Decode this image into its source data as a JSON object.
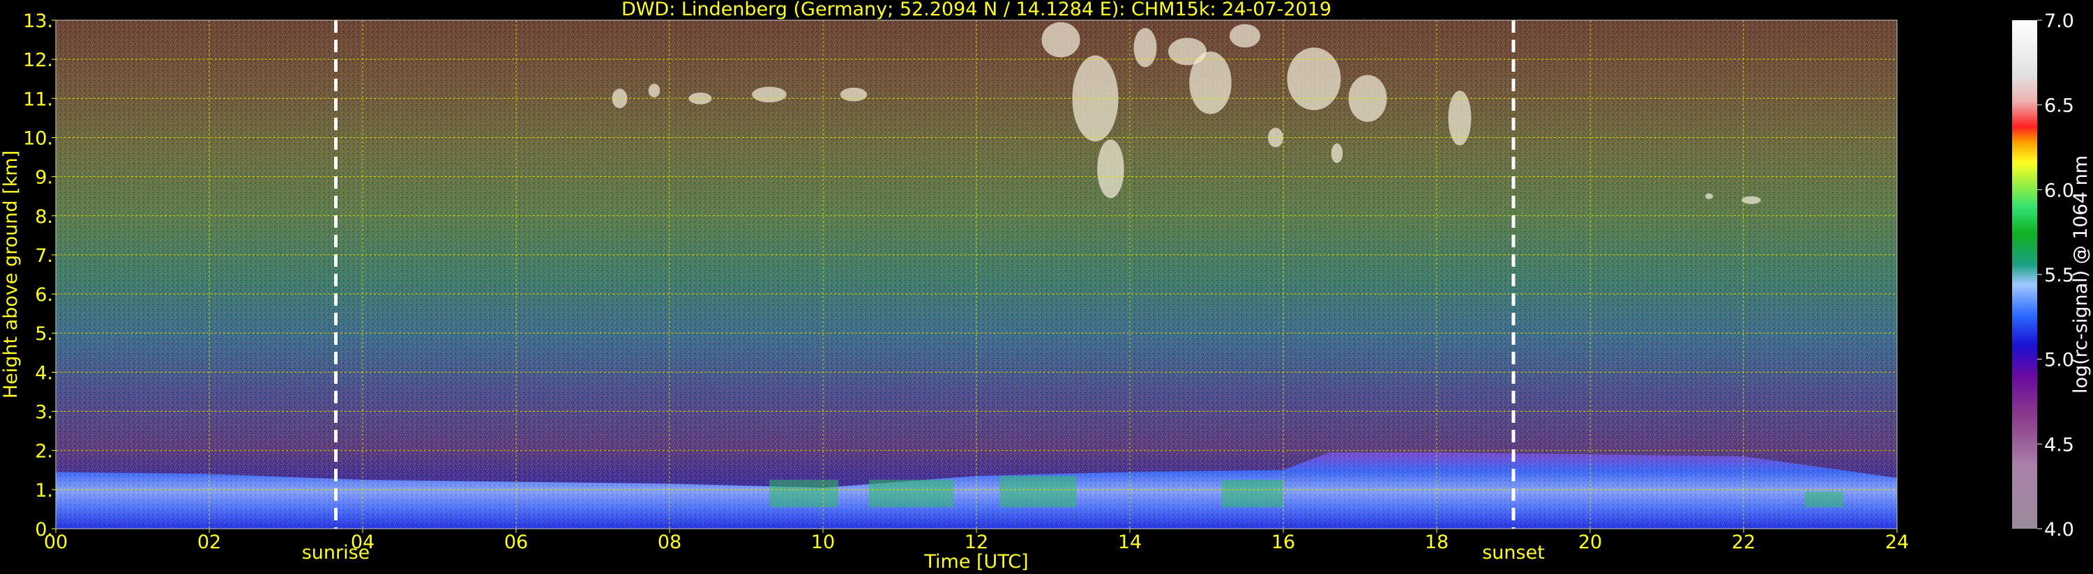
{
  "chart_data": {
    "type": "heatmap",
    "title": "DWD: Lindenberg (Germany; 52.2094 N / 14.1284 E):    CHM15k: 24-07-2019",
    "xlabel": "Time [UTC]",
    "ylabel": "Height above ground [km]",
    "colorbar_label": "log(rc-signal) @ 1064 nm",
    "xlim": [
      0,
      24
    ],
    "ylim": [
      0,
      13
    ],
    "x_ticks": [
      "00",
      "02",
      "04",
      "06",
      "08",
      "10",
      "12",
      "14",
      "16",
      "18",
      "20",
      "22",
      "24"
    ],
    "y_ticks": [
      "0.",
      "1.",
      "2.",
      "3.",
      "4.",
      "5.",
      "6.",
      "7.",
      "8.",
      "9.",
      "10.",
      "11.",
      "12.",
      "13."
    ],
    "colorbar_range": [
      4.0,
      7.0
    ],
    "colorbar_ticks": [
      "4.0",
      "4.5",
      "5.0",
      "5.5",
      "6.0",
      "6.5",
      "7.0"
    ],
    "grid": true,
    "grid_color": "#e8e800",
    "annotations": [
      {
        "label": "sunrise",
        "x": 3.65
      },
      {
        "label": "sunset",
        "x": 19.0
      }
    ],
    "boundary_layer_top_km": [
      [
        0,
        1.45
      ],
      [
        2,
        1.4
      ],
      [
        4,
        1.25
      ],
      [
        6,
        1.2
      ],
      [
        8,
        1.15
      ],
      [
        10,
        1.05
      ],
      [
        12,
        1.35
      ],
      [
        14,
        1.45
      ],
      [
        16,
        1.5
      ],
      [
        16.6,
        1.95
      ],
      [
        18,
        1.95
      ],
      [
        20,
        1.9
      ],
      [
        22,
        1.85
      ],
      [
        24,
        1.3
      ]
    ],
    "cloud_cells": [
      {
        "x": 7.35,
        "km": 11.0,
        "w": 0.2,
        "h": 0.5
      },
      {
        "x": 7.8,
        "km": 11.2,
        "w": 0.15,
        "h": 0.35
      },
      {
        "x": 8.4,
        "km": 11.0,
        "w": 0.3,
        "h": 0.3
      },
      {
        "x": 9.3,
        "km": 11.1,
        "w": 0.45,
        "h": 0.4
      },
      {
        "x": 10.4,
        "km": 11.1,
        "w": 0.35,
        "h": 0.35
      },
      {
        "x": 13.1,
        "km": 12.5,
        "w": 0.5,
        "h": 0.9
      },
      {
        "x": 13.55,
        "km": 11.0,
        "w": 0.6,
        "h": 2.2
      },
      {
        "x": 13.75,
        "km": 9.2,
        "w": 0.35,
        "h": 1.5
      },
      {
        "x": 14.2,
        "km": 12.3,
        "w": 0.3,
        "h": 1.0
      },
      {
        "x": 14.75,
        "km": 12.2,
        "w": 0.5,
        "h": 0.7
      },
      {
        "x": 15.05,
        "km": 11.4,
        "w": 0.55,
        "h": 1.6
      },
      {
        "x": 15.5,
        "km": 12.6,
        "w": 0.4,
        "h": 0.6
      },
      {
        "x": 15.9,
        "km": 10.0,
        "w": 0.2,
        "h": 0.5
      },
      {
        "x": 16.4,
        "km": 11.5,
        "w": 0.7,
        "h": 1.6
      },
      {
        "x": 16.7,
        "km": 9.6,
        "w": 0.15,
        "h": 0.5
      },
      {
        "x": 17.1,
        "km": 11.0,
        "w": 0.5,
        "h": 1.2
      },
      {
        "x": 18.3,
        "km": 10.5,
        "w": 0.3,
        "h": 1.4
      },
      {
        "x": 21.55,
        "km": 8.5,
        "w": 0.1,
        "h": 0.15
      },
      {
        "x": 22.1,
        "km": 8.4,
        "w": 0.25,
        "h": 0.2
      }
    ]
  }
}
